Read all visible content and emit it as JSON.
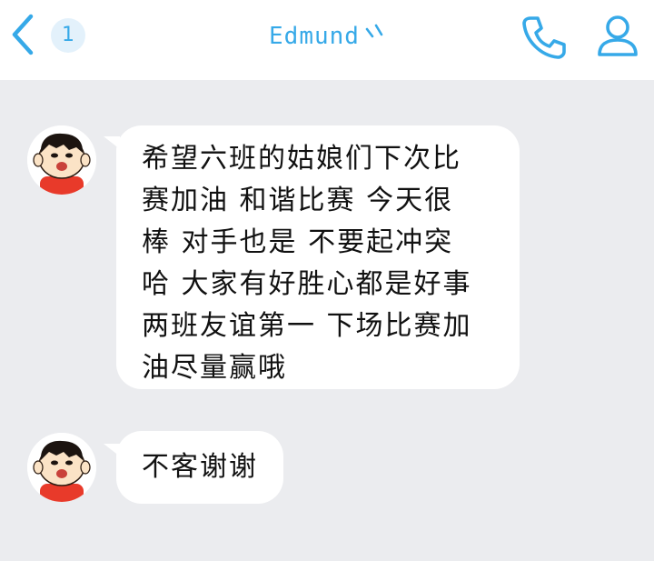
{
  "header": {
    "back_icon": "chevron-left-icon",
    "unread_count": "1",
    "contact_name": "Edmund",
    "contact_mark": "checkmark-icon",
    "phone_icon": "phone-icon",
    "profile_icon": "user-profile-icon"
  },
  "messages": [
    {
      "sender": "incoming",
      "text": "希望六班的姑娘们下次比\n赛加油 和谐比赛 今天很\n棒 对手也是 不要起冲突\n哈 大家有好胜心都是好事\n两班友谊第一 下场比赛加\n油尽量赢哦"
    },
    {
      "sender": "incoming",
      "text": "不客谢谢"
    }
  ],
  "colors": {
    "accent": "#36a9e8",
    "background": "#ebecef",
    "bubble": "#ffffff",
    "avatar_face": "#fbe3c6",
    "avatar_shirt": "#e83a2a"
  }
}
